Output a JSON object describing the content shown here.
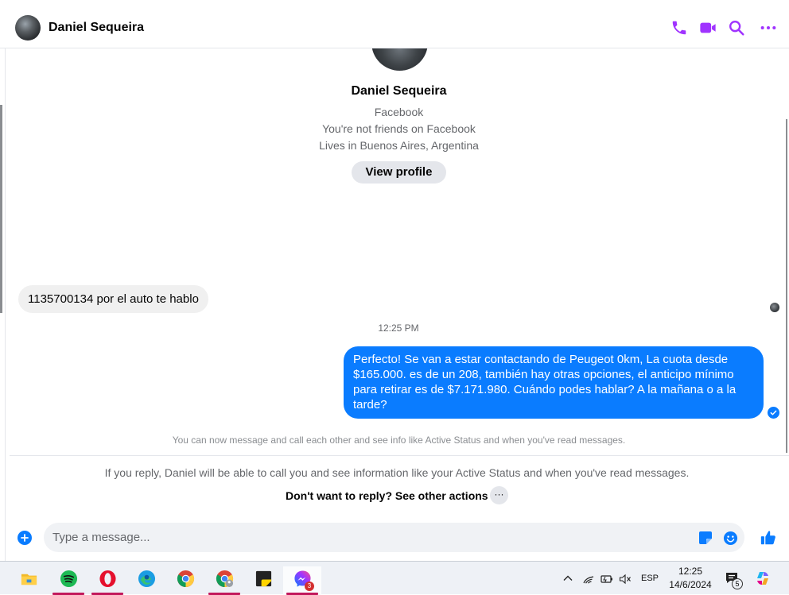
{
  "header": {
    "contact_name": "Daniel Sequeira",
    "icons": [
      "phone-icon",
      "video-camera-icon",
      "search-icon",
      "more-options-icon"
    ]
  },
  "profile": {
    "name": "Daniel Sequeira",
    "source": "Facebook",
    "friend_status": "You're not friends on Facebook",
    "location": "Lives in Buenos Aires, Argentina",
    "view_profile_label": "View profile"
  },
  "messages": {
    "incoming_text": "1135700134 por el auto te hablo",
    "timestamp": "12:25 PM",
    "outgoing_text": "Perfecto!  Se van a estar contactando de Peugeot 0km, La cuota desde $165.000. es de un 208, también hay otras opciones, el anticipo mínimo para retirar es de $7.171.980. Cuándo podes hablar? A la mañana o a la tarde?",
    "info_line": "You can now message and call each other and see info like Active Status and when you've read messages."
  },
  "reply_notice": {
    "text": "If you reply, Daniel will be able to call you and see information like your Active Status and when you've read messages.",
    "other_actions_label": "Don't want to reply? See other actions",
    "more_label": "···"
  },
  "composer": {
    "placeholder": "Type a message..."
  },
  "taskbar": {
    "apps": [
      "file-explorer-icon",
      "spotify-icon",
      "opera-icon",
      "edge-icon",
      "chrome-icon",
      "chrome-profile-icon",
      "sticky-notes-icon",
      "messenger-icon"
    ],
    "messenger_badge": "3",
    "language": "ESP",
    "time": "12:25",
    "date": "14/6/2024",
    "notification_count": "5"
  },
  "colors": {
    "accent": "#0a7cff",
    "header_icon": "#a033ff"
  }
}
